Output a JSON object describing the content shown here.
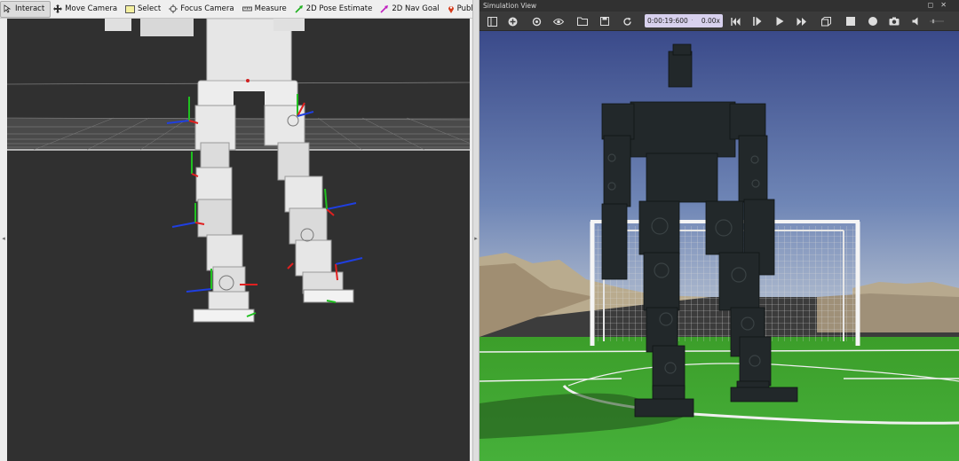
{
  "rviz": {
    "toolbar": {
      "interact": "Interact",
      "move_camera": "Move Camera",
      "select": "Select",
      "focus_camera": "Focus Camera",
      "measure": "Measure",
      "pose_estimate": "2D Pose Estimate",
      "nav_goal": "2D Nav Goal",
      "publish_point": "Publish Point"
    },
    "viewport": {
      "background": "#303030",
      "grid_color": "#9a9a9a",
      "robot_color": "#eeeeee",
      "axis_colors": {
        "x": "#e02020",
        "y": "#20c020",
        "z": "#1f3fe0"
      }
    }
  },
  "simulation": {
    "title": "Simulation View",
    "toolbar": {
      "sim_time": "0:00:19:600",
      "speed": "0.00x",
      "icons": [
        "sidebar-toggle-icon",
        "add-icon",
        "rotate-icon",
        "eye-icon",
        "open-folder-icon",
        "save-icon",
        "reload-icon",
        "step-back-icon",
        "pause-step-icon",
        "play-icon",
        "fast-forward-icon",
        "cube-icon",
        "stop-icon",
        "record-icon",
        "camera-icon",
        "sound-icon"
      ]
    },
    "scene": {
      "sky_top": "#3c4d8c",
      "sky_horizon": "#8ea3c6",
      "grass": "#3aa52a",
      "robot_color": "#202424",
      "goal_color": "#f2f2f2"
    }
  }
}
